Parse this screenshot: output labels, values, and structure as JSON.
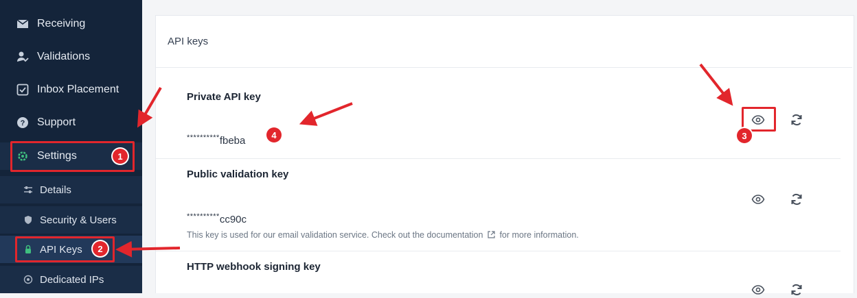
{
  "sidebar": {
    "items": [
      {
        "label": "Receiving",
        "icon": "inbox-icon"
      },
      {
        "label": "Validations",
        "icon": "user-check-icon"
      },
      {
        "label": "Inbox Placement",
        "icon": "checkbox-icon"
      },
      {
        "label": "Support",
        "icon": "help-icon"
      },
      {
        "label": "Settings",
        "icon": "gear-icon"
      }
    ],
    "sub_items": [
      {
        "label": "Details",
        "icon": "sliders-icon"
      },
      {
        "label": "Security & Users",
        "icon": "shield-icon"
      },
      {
        "label": "API Keys",
        "icon": "key-icon"
      },
      {
        "label": "Dedicated IPs",
        "icon": "target-icon"
      }
    ]
  },
  "main": {
    "title": "API keys",
    "keys": [
      {
        "title": "Private API key",
        "masked": "**********",
        "suffix": "fbeba",
        "description": ""
      },
      {
        "title": "Public validation key",
        "masked": "**********",
        "suffix": "cc90c",
        "description_before": "This key is used for our email validation service. Check out the documentation",
        "description_after": "for more information."
      },
      {
        "title": "HTTP webhook signing key",
        "masked": "",
        "suffix": "",
        "description": ""
      }
    ]
  },
  "annotations": {
    "badges": [
      "1",
      "2",
      "3",
      "4"
    ],
    "color": "#e2262c"
  },
  "colors": {
    "sidebar_bg": "#14243a",
    "submenu_bg": "#1a2d47",
    "accent_green": "#3fbf7f",
    "annotation_red": "#e2262c"
  }
}
